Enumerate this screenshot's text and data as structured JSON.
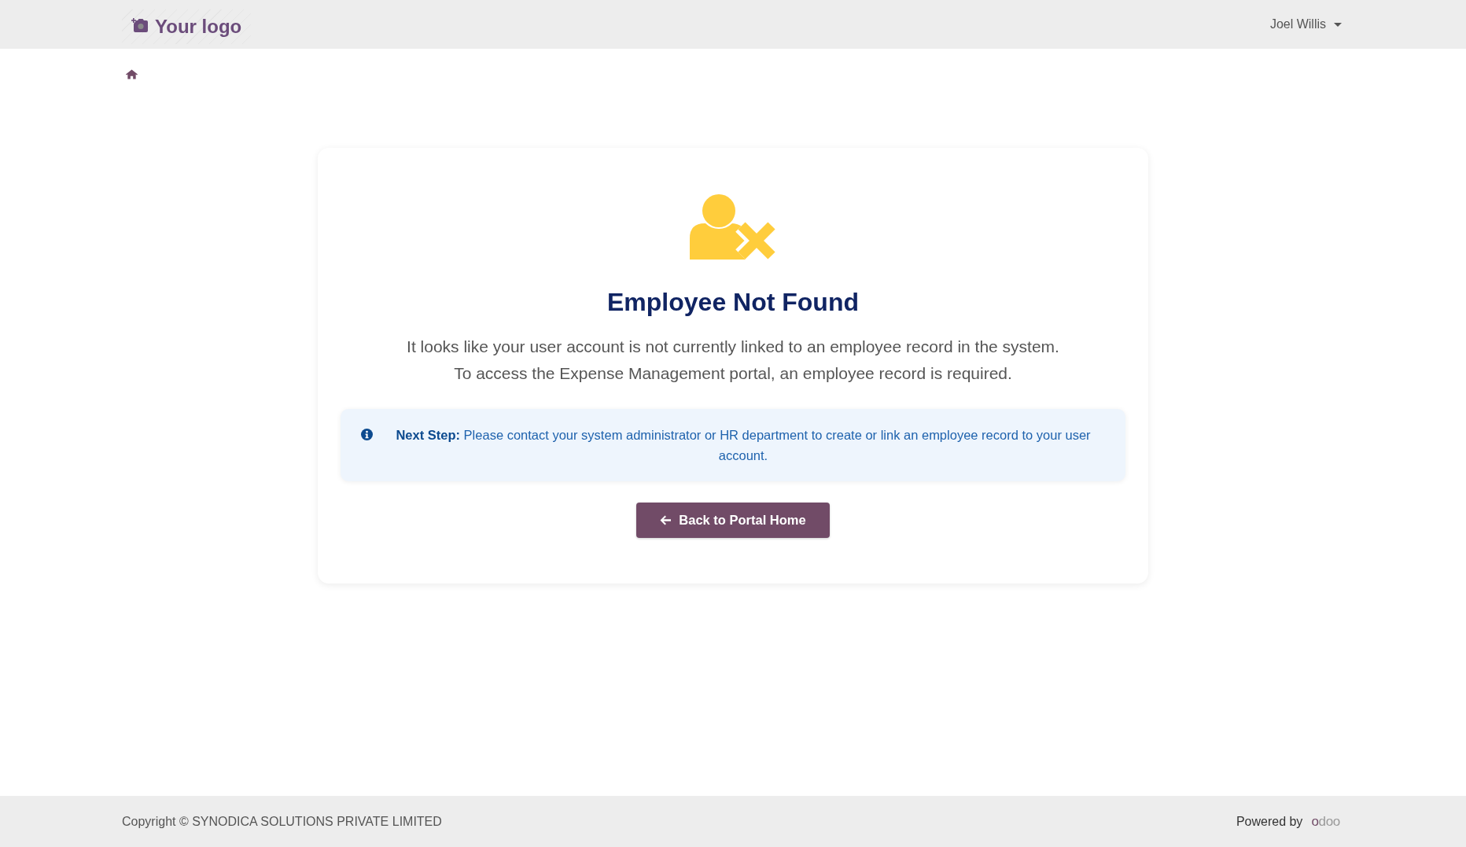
{
  "header": {
    "logo": {
      "text": "Your logo"
    },
    "user_menu": {
      "name": "Joel Willis"
    }
  },
  "card": {
    "title": "Employee Not Found",
    "message_lines": [
      "It looks like your user account is not currently linked to an employee record in the system.",
      "To access the Expense Management portal, an employee record is required."
    ],
    "notice": {
      "text": "**Next Step:** Please contact your system administrator or HR department to create or link an employee record to your user account."
    },
    "button": {
      "label": "Back to Portal Home"
    }
  },
  "footer": {
    "copyright": "Copyright © SYNODICA SOLUTIONS PRIVATE LIMITED",
    "powered_by": {
      "label": "Powered by",
      "brand": "odoo"
    }
  }
}
